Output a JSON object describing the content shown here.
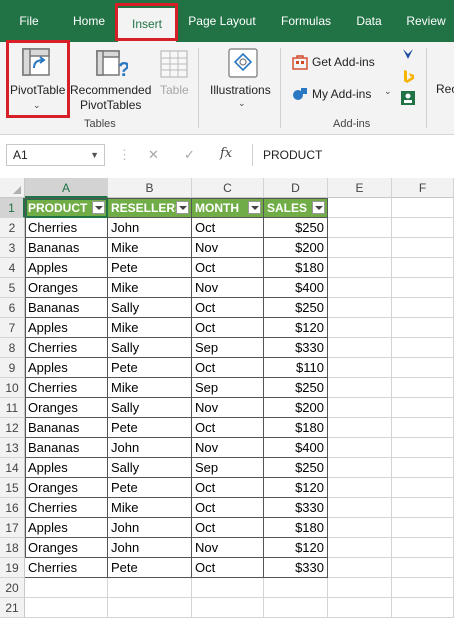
{
  "tabs": [
    "File",
    "Home",
    "Insert",
    "Page Layout",
    "Formulas",
    "Data",
    "Review"
  ],
  "ribbon": {
    "pivot_table": "PivotTable",
    "recommended_line1": "Recommended",
    "recommended_line2": "PivotTables",
    "table": "Table",
    "tables_group": "Tables",
    "illustrations": "Illustrations",
    "get_addins": "Get Add-ins",
    "my_addins": "My Add-ins",
    "addins_group": "Add-ins",
    "rec_cut": "Rec"
  },
  "formula_bar": {
    "name_box": "A1",
    "fx": "fx",
    "content": "PRODUCT"
  },
  "columns": [
    "A",
    "B",
    "C",
    "D",
    "E",
    "F"
  ],
  "rows": [
    "1",
    "2",
    "3",
    "4",
    "5",
    "6",
    "7",
    "8",
    "9",
    "10",
    "11",
    "12",
    "13",
    "14",
    "15",
    "16",
    "17",
    "18",
    "19",
    "20",
    "21"
  ],
  "table": {
    "headers": [
      "PRODUCT",
      "RESELLERS",
      "MONTH",
      "SALES"
    ],
    "rows": [
      [
        "Cherries",
        "John",
        "Oct",
        "$250"
      ],
      [
        "Bananas",
        "Mike",
        "Nov",
        "$200"
      ],
      [
        "Apples",
        "Pete",
        "Oct",
        "$180"
      ],
      [
        "Oranges",
        "Mike",
        "Nov",
        "$400"
      ],
      [
        "Bananas",
        "Sally",
        "Oct",
        "$250"
      ],
      [
        "Apples",
        "Mike",
        "Oct",
        "$120"
      ],
      [
        "Cherries",
        "Sally",
        "Sep",
        "$330"
      ],
      [
        "Apples",
        "Pete",
        "Oct",
        "$110"
      ],
      [
        "Cherries",
        "Mike",
        "Sep",
        "$250"
      ],
      [
        "Oranges",
        "Sally",
        "Nov",
        "$200"
      ],
      [
        "Bananas",
        "Pete",
        "Oct",
        "$180"
      ],
      [
        "Bananas",
        "John",
        "Nov",
        "$400"
      ],
      [
        "Apples",
        "Sally",
        "Sep",
        "$250"
      ],
      [
        "Oranges",
        "Pete",
        "Oct",
        "$120"
      ],
      [
        "Cherries",
        "Mike",
        "Oct",
        "$330"
      ],
      [
        "Apples",
        "John",
        "Oct",
        "$180"
      ],
      [
        "Oranges",
        "John",
        "Nov",
        "$120"
      ],
      [
        "Cherries",
        "Pete",
        "Oct",
        "$330"
      ]
    ]
  },
  "colors": {
    "excel_green": "#217346",
    "table_header": "#70ad47",
    "highlight": "#d61f26"
  }
}
